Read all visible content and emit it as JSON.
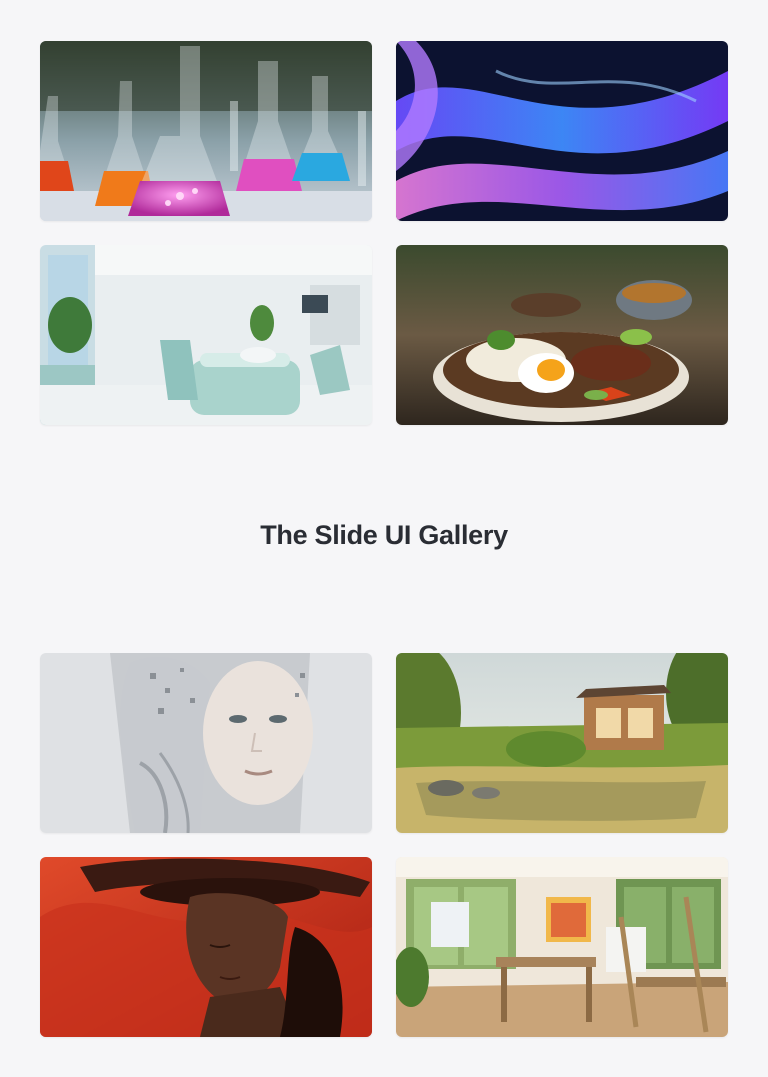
{
  "gallery": {
    "title": "The Slide UI Gallery",
    "top_images": [
      {
        "subject": "chemistry glassware with colorful liquids"
      },
      {
        "subject": "abstract blue and purple ribbons"
      },
      {
        "subject": "bright dental clinic interior"
      },
      {
        "subject": "rice bowl with fried egg and beef"
      }
    ],
    "bottom_images": [
      {
        "subject": "robotic woman portrait"
      },
      {
        "subject": "garden pond and wooden house"
      },
      {
        "subject": "woman in red hat portrait"
      },
      {
        "subject": "sunlit art studio with easels"
      }
    ]
  },
  "colors": {
    "background": "#f6f6f8",
    "title": "#2a2d34"
  }
}
